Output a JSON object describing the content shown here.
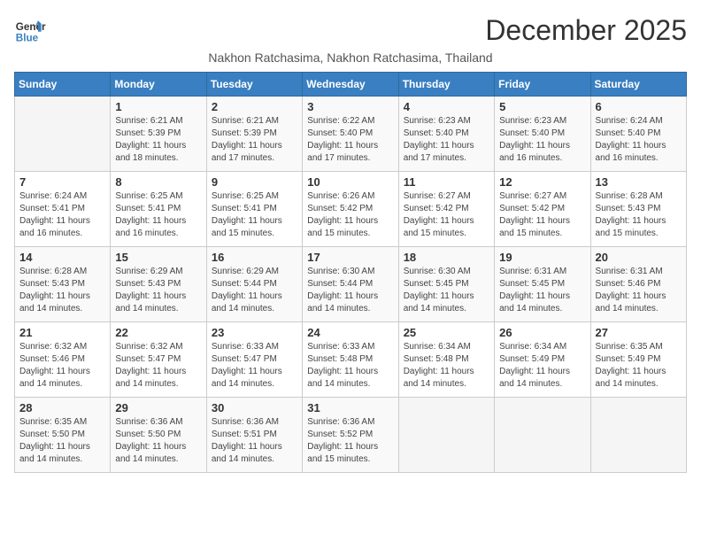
{
  "logo": {
    "line1": "General",
    "line2": "Blue"
  },
  "title": "December 2025",
  "subtitle": "Nakhon Ratchasima, Nakhon Ratchasima, Thailand",
  "days_of_week": [
    "Sunday",
    "Monday",
    "Tuesday",
    "Wednesday",
    "Thursday",
    "Friday",
    "Saturday"
  ],
  "weeks": [
    [
      {
        "day": "",
        "info": ""
      },
      {
        "day": "1",
        "info": "Sunrise: 6:21 AM\nSunset: 5:39 PM\nDaylight: 11 hours\nand 18 minutes."
      },
      {
        "day": "2",
        "info": "Sunrise: 6:21 AM\nSunset: 5:39 PM\nDaylight: 11 hours\nand 17 minutes."
      },
      {
        "day": "3",
        "info": "Sunrise: 6:22 AM\nSunset: 5:40 PM\nDaylight: 11 hours\nand 17 minutes."
      },
      {
        "day": "4",
        "info": "Sunrise: 6:23 AM\nSunset: 5:40 PM\nDaylight: 11 hours\nand 17 minutes."
      },
      {
        "day": "5",
        "info": "Sunrise: 6:23 AM\nSunset: 5:40 PM\nDaylight: 11 hours\nand 16 minutes."
      },
      {
        "day": "6",
        "info": "Sunrise: 6:24 AM\nSunset: 5:40 PM\nDaylight: 11 hours\nand 16 minutes."
      }
    ],
    [
      {
        "day": "7",
        "info": "Sunrise: 6:24 AM\nSunset: 5:41 PM\nDaylight: 11 hours\nand 16 minutes."
      },
      {
        "day": "8",
        "info": "Sunrise: 6:25 AM\nSunset: 5:41 PM\nDaylight: 11 hours\nand 16 minutes."
      },
      {
        "day": "9",
        "info": "Sunrise: 6:25 AM\nSunset: 5:41 PM\nDaylight: 11 hours\nand 15 minutes."
      },
      {
        "day": "10",
        "info": "Sunrise: 6:26 AM\nSunset: 5:42 PM\nDaylight: 11 hours\nand 15 minutes."
      },
      {
        "day": "11",
        "info": "Sunrise: 6:27 AM\nSunset: 5:42 PM\nDaylight: 11 hours\nand 15 minutes."
      },
      {
        "day": "12",
        "info": "Sunrise: 6:27 AM\nSunset: 5:42 PM\nDaylight: 11 hours\nand 15 minutes."
      },
      {
        "day": "13",
        "info": "Sunrise: 6:28 AM\nSunset: 5:43 PM\nDaylight: 11 hours\nand 15 minutes."
      }
    ],
    [
      {
        "day": "14",
        "info": "Sunrise: 6:28 AM\nSunset: 5:43 PM\nDaylight: 11 hours\nand 14 minutes."
      },
      {
        "day": "15",
        "info": "Sunrise: 6:29 AM\nSunset: 5:43 PM\nDaylight: 11 hours\nand 14 minutes."
      },
      {
        "day": "16",
        "info": "Sunrise: 6:29 AM\nSunset: 5:44 PM\nDaylight: 11 hours\nand 14 minutes."
      },
      {
        "day": "17",
        "info": "Sunrise: 6:30 AM\nSunset: 5:44 PM\nDaylight: 11 hours\nand 14 minutes."
      },
      {
        "day": "18",
        "info": "Sunrise: 6:30 AM\nSunset: 5:45 PM\nDaylight: 11 hours\nand 14 minutes."
      },
      {
        "day": "19",
        "info": "Sunrise: 6:31 AM\nSunset: 5:45 PM\nDaylight: 11 hours\nand 14 minutes."
      },
      {
        "day": "20",
        "info": "Sunrise: 6:31 AM\nSunset: 5:46 PM\nDaylight: 11 hours\nand 14 minutes."
      }
    ],
    [
      {
        "day": "21",
        "info": "Sunrise: 6:32 AM\nSunset: 5:46 PM\nDaylight: 11 hours\nand 14 minutes."
      },
      {
        "day": "22",
        "info": "Sunrise: 6:32 AM\nSunset: 5:47 PM\nDaylight: 11 hours\nand 14 minutes."
      },
      {
        "day": "23",
        "info": "Sunrise: 6:33 AM\nSunset: 5:47 PM\nDaylight: 11 hours\nand 14 minutes."
      },
      {
        "day": "24",
        "info": "Sunrise: 6:33 AM\nSunset: 5:48 PM\nDaylight: 11 hours\nand 14 minutes."
      },
      {
        "day": "25",
        "info": "Sunrise: 6:34 AM\nSunset: 5:48 PM\nDaylight: 11 hours\nand 14 minutes."
      },
      {
        "day": "26",
        "info": "Sunrise: 6:34 AM\nSunset: 5:49 PM\nDaylight: 11 hours\nand 14 minutes."
      },
      {
        "day": "27",
        "info": "Sunrise: 6:35 AM\nSunset: 5:49 PM\nDaylight: 11 hours\nand 14 minutes."
      }
    ],
    [
      {
        "day": "28",
        "info": "Sunrise: 6:35 AM\nSunset: 5:50 PM\nDaylight: 11 hours\nand 14 minutes."
      },
      {
        "day": "29",
        "info": "Sunrise: 6:36 AM\nSunset: 5:50 PM\nDaylight: 11 hours\nand 14 minutes."
      },
      {
        "day": "30",
        "info": "Sunrise: 6:36 AM\nSunset: 5:51 PM\nDaylight: 11 hours\nand 14 minutes."
      },
      {
        "day": "31",
        "info": "Sunrise: 6:36 AM\nSunset: 5:52 PM\nDaylight: 11 hours\nand 15 minutes."
      },
      {
        "day": "",
        "info": ""
      },
      {
        "day": "",
        "info": ""
      },
      {
        "day": "",
        "info": ""
      }
    ]
  ]
}
